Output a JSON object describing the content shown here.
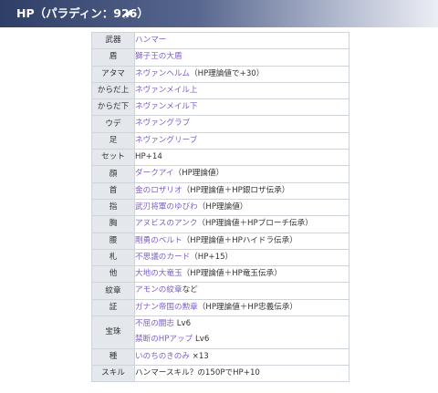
{
  "header": {
    "title": "HP（パラディン：926）",
    "edit_icon": "pencil-icon"
  },
  "rows": [
    {
      "label": "武器",
      "lines": [
        {
          "link": "ハンマー",
          "note": ""
        }
      ]
    },
    {
      "label": "盾",
      "lines": [
        {
          "link": "獅子王の大盾",
          "note": ""
        }
      ]
    },
    {
      "label": "アタマ",
      "lines": [
        {
          "link": "ネヴァンヘルム",
          "note": "（HP理論値で+30）"
        }
      ]
    },
    {
      "label": "からだ上",
      "lines": [
        {
          "link": "ネヴァンメイル上",
          "note": ""
        }
      ]
    },
    {
      "label": "からだ下",
      "lines": [
        {
          "link": "ネヴァンメイル下",
          "note": ""
        }
      ]
    },
    {
      "label": "ウデ",
      "lines": [
        {
          "link": "ネヴァングラブ",
          "note": ""
        }
      ]
    },
    {
      "label": "足",
      "lines": [
        {
          "link": "ネヴァングリーブ",
          "note": ""
        }
      ]
    },
    {
      "label": "セット",
      "lines": [
        {
          "link": "",
          "note": "HP+14"
        }
      ]
    },
    {
      "label": "顔",
      "lines": [
        {
          "link": "ダークアイ",
          "note": "（HP理論値）"
        }
      ]
    },
    {
      "label": "首",
      "lines": [
        {
          "link": "金のロザリオ",
          "note": "（HP理論値＋HP銀ロザ伝承）"
        }
      ]
    },
    {
      "label": "指",
      "lines": [
        {
          "link": "武刃将軍のゆびわ",
          "note": "（HP理論値）"
        }
      ]
    },
    {
      "label": "胸",
      "lines": [
        {
          "link": "アヌビスのアンク",
          "note": "（HP理論値＋HPブローチ伝承）"
        }
      ]
    },
    {
      "label": "腰",
      "lines": [
        {
          "link": "剛勇のベルト",
          "note": "（HP理論値＋HPハイドラ伝承）"
        }
      ]
    },
    {
      "label": "札",
      "lines": [
        {
          "link": "不思議のカード",
          "note": "（HP+15）"
        }
      ]
    },
    {
      "label": "他",
      "lines": [
        {
          "link": "大地の大竜玉",
          "note": "（HP理論値＋HP竜玉伝承）"
        }
      ]
    },
    {
      "label": "紋章",
      "lines": [
        {
          "link": "アモンの紋章",
          "note": "など"
        }
      ]
    },
    {
      "label": "証",
      "lines": [
        {
          "link": "ガナン帝国の勲章",
          "note": "（HP理論値＋HP忠義伝承）"
        }
      ]
    },
    {
      "label": "宝珠",
      "lines": [
        {
          "link": "不屈の闘志",
          "note": " Lv6"
        },
        {
          "link": "禁断のHPアップ",
          "note": " Lv6"
        }
      ]
    },
    {
      "label": "種",
      "lines": [
        {
          "link": "いのちのきのみ",
          "note": " ×13"
        }
      ]
    },
    {
      "label": "スキル",
      "lines": [
        {
          "link": "",
          "note": "ハンマースキル？の150PでHP+10"
        }
      ]
    }
  ]
}
